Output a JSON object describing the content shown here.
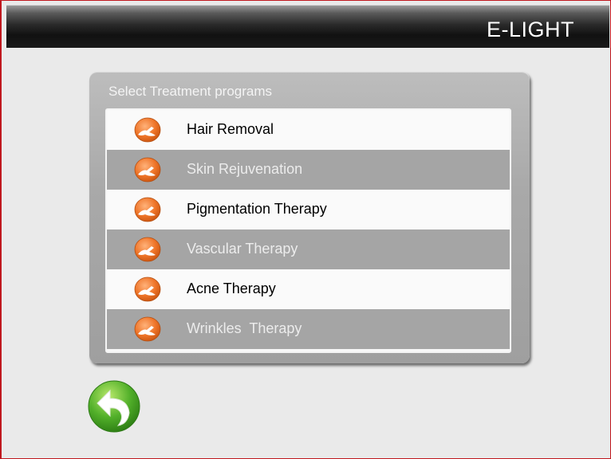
{
  "header": {
    "title": "E-LIGHT"
  },
  "panel": {
    "title": "Select Treatment programs",
    "items": [
      {
        "label": "Hair Removal",
        "icon": "treatment-icon",
        "style": "light"
      },
      {
        "label": "Skin Rejuvenation",
        "icon": "treatment-icon",
        "style": "dark"
      },
      {
        "label": "Pigmentation Therapy",
        "icon": "treatment-icon",
        "style": "light"
      },
      {
        "label": "Vascular Therapy",
        "icon": "treatment-icon",
        "style": "dark"
      },
      {
        "label": "Acne Therapy",
        "icon": "treatment-icon",
        "style": "light"
      },
      {
        "label": "Wrinkles  Therapy",
        "icon": "treatment-icon",
        "style": "dark"
      }
    ]
  },
  "back_button": {
    "icon": "back-arrow-icon"
  },
  "colors": {
    "frame": "#c0181f",
    "icon_orange": "#e8772a",
    "back_green": "#4fa82a"
  }
}
